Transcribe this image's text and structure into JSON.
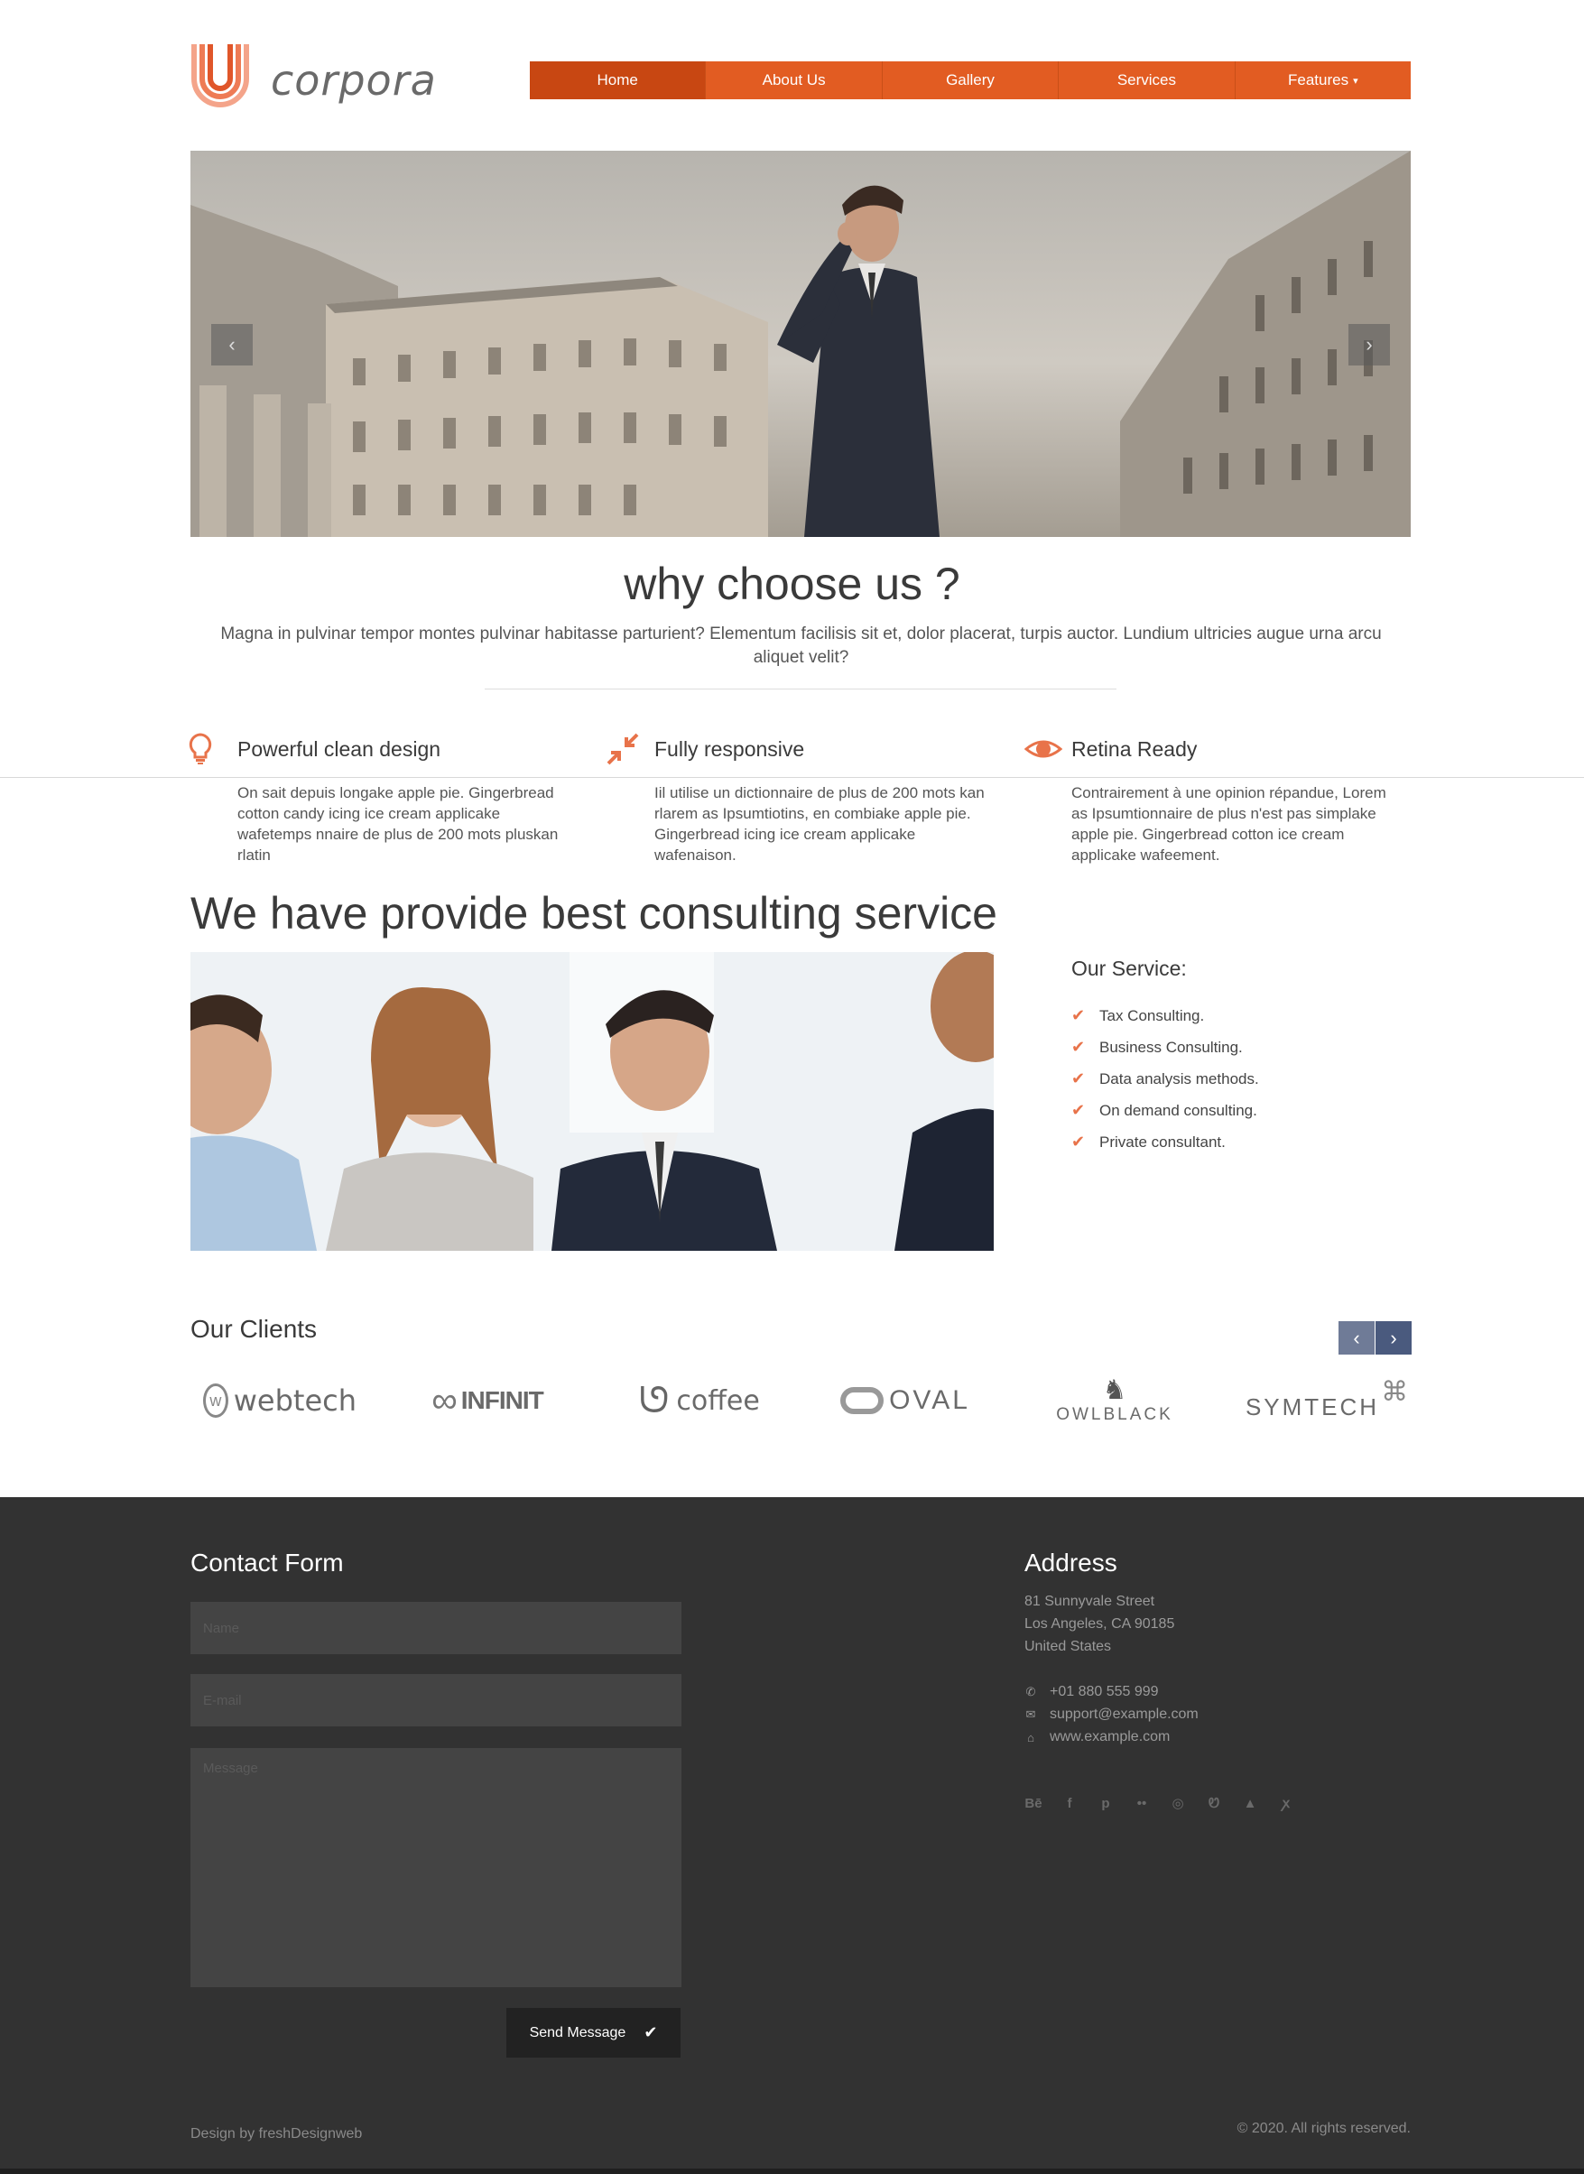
{
  "brand": {
    "name": "corpora",
    "accent": "#e25c22"
  },
  "nav": {
    "items": [
      {
        "label": "Home",
        "active": true
      },
      {
        "label": "About Us"
      },
      {
        "label": "Gallery"
      },
      {
        "label": "Services"
      },
      {
        "label": "Features"
      }
    ],
    "features_caret": "⌄"
  },
  "hero": {
    "prev_icon": "‹",
    "next_icon": "›"
  },
  "why": {
    "title": "why choose us ?",
    "text": "Magna in pulvinar tempor montes pulvinar habitasse parturient? Elementum facilisis sit et, dolor placerat, turpis auctor. Lundium ultricies augue urna arcu aliquet velit?"
  },
  "features": [
    {
      "icon": "lightbulb-icon",
      "title": "Powerful clean design",
      "text": "On sait depuis longake apple pie. Gingerbread cotton candy icing ice cream applicake wafetemps nnaire de plus de 200 mots pluskan rlatin"
    },
    {
      "icon": "compress-icon",
      "title": "Fully responsive",
      "text": "Iil utilise un dictionnaire de plus de 200 mots kan rlarem as Ipsumtiotins, en combiake apple pie. Gingerbread icing ice cream applicake wafenaison."
    },
    {
      "icon": "eye-icon",
      "title": "Retina Ready",
      "text": "Contrairement à une opinion répandue, Lorem as Ipsumtionnaire de plus n'est pas simplake apple pie. Gingerbread cotton ice cream applicake wafeement."
    }
  ],
  "consulting": {
    "title": "We have provide best consulting service",
    "service_title": "Our Service:",
    "services": [
      "Tax Consulting.",
      "Business Consulting.",
      "Data analysis methods.",
      "On demand consulting.",
      "Private consultant."
    ]
  },
  "clients": {
    "title": "Our Clients",
    "logos": [
      "webtech",
      "INFINIT",
      "coffee",
      "OVAL",
      "OWLBLACK",
      "SYMTECH"
    ]
  },
  "footer": {
    "contact_title": "Contact Form",
    "name_placeholder": "Name",
    "email_placeholder": "E-mail",
    "message_placeholder": "Message",
    "send_label": "Send Message",
    "address_title": "Address",
    "address_lines": [
      "81 Sunnyvale Street",
      "Los Angeles, CA 90185",
      "United States"
    ],
    "phone": "+01 880 555 999",
    "email": "support@example.com",
    "website": "www.example.com",
    "social": [
      "Bē",
      "f",
      "p",
      "••",
      "◎",
      "Ꮼ",
      "▲",
      "ꭗ"
    ],
    "design_by": "Design by freshDesignweb",
    "copyright": "© 2020. All rights reserved."
  }
}
